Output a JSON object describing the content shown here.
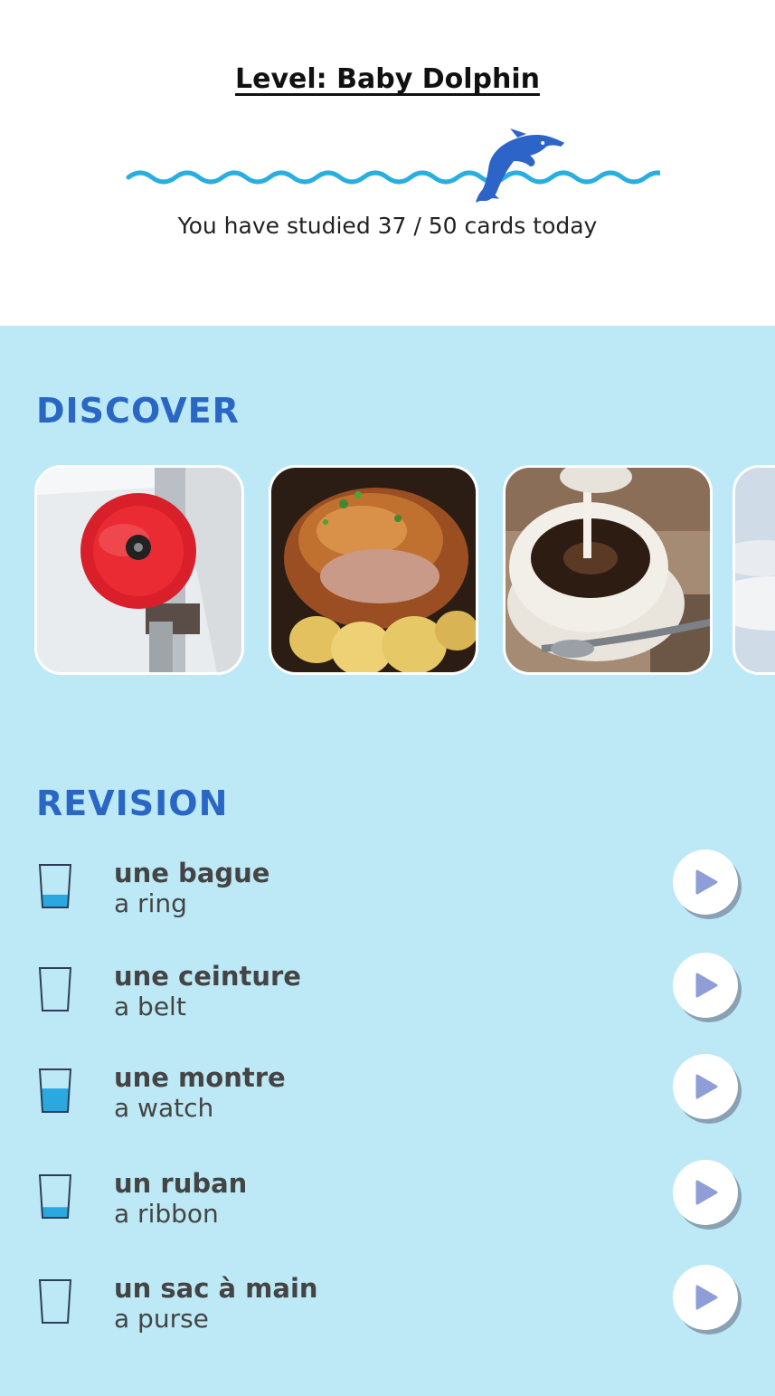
{
  "header": {
    "level_title": "Level: Baby Dolphin",
    "studied_text": "You have studied 37 / 50 cards today",
    "progress": {
      "studied": 37,
      "total": 50
    },
    "mascot_icon": "dolphin-icon"
  },
  "colors": {
    "panel_bg": "#bde9f6",
    "section_title": "#2a66c4",
    "wave": "#29aee0",
    "dolphin": "#2d64c8",
    "glass_fill": "#2aa9e0"
  },
  "discover": {
    "title": "DISCOVER",
    "cards": [
      {
        "subject": "red alarm bell"
      },
      {
        "subject": "roast duck with potatoes"
      },
      {
        "subject": "coffee with milk"
      },
      {
        "subject": "clouds"
      }
    ]
  },
  "revision": {
    "title": "REVISION",
    "items": [
      {
        "word": "une bague",
        "translation": "a ring",
        "level": 0.3
      },
      {
        "word": "une ceinture",
        "translation": "a belt",
        "level": 0
      },
      {
        "word": "une montre",
        "translation": "a watch",
        "level": 0.55
      },
      {
        "word": "un ruban",
        "translation": "a ribbon",
        "level": 0.25
      },
      {
        "word": "un sac à main",
        "translation": "a purse",
        "level": 0
      }
    ],
    "play_icon": "play-icon"
  }
}
